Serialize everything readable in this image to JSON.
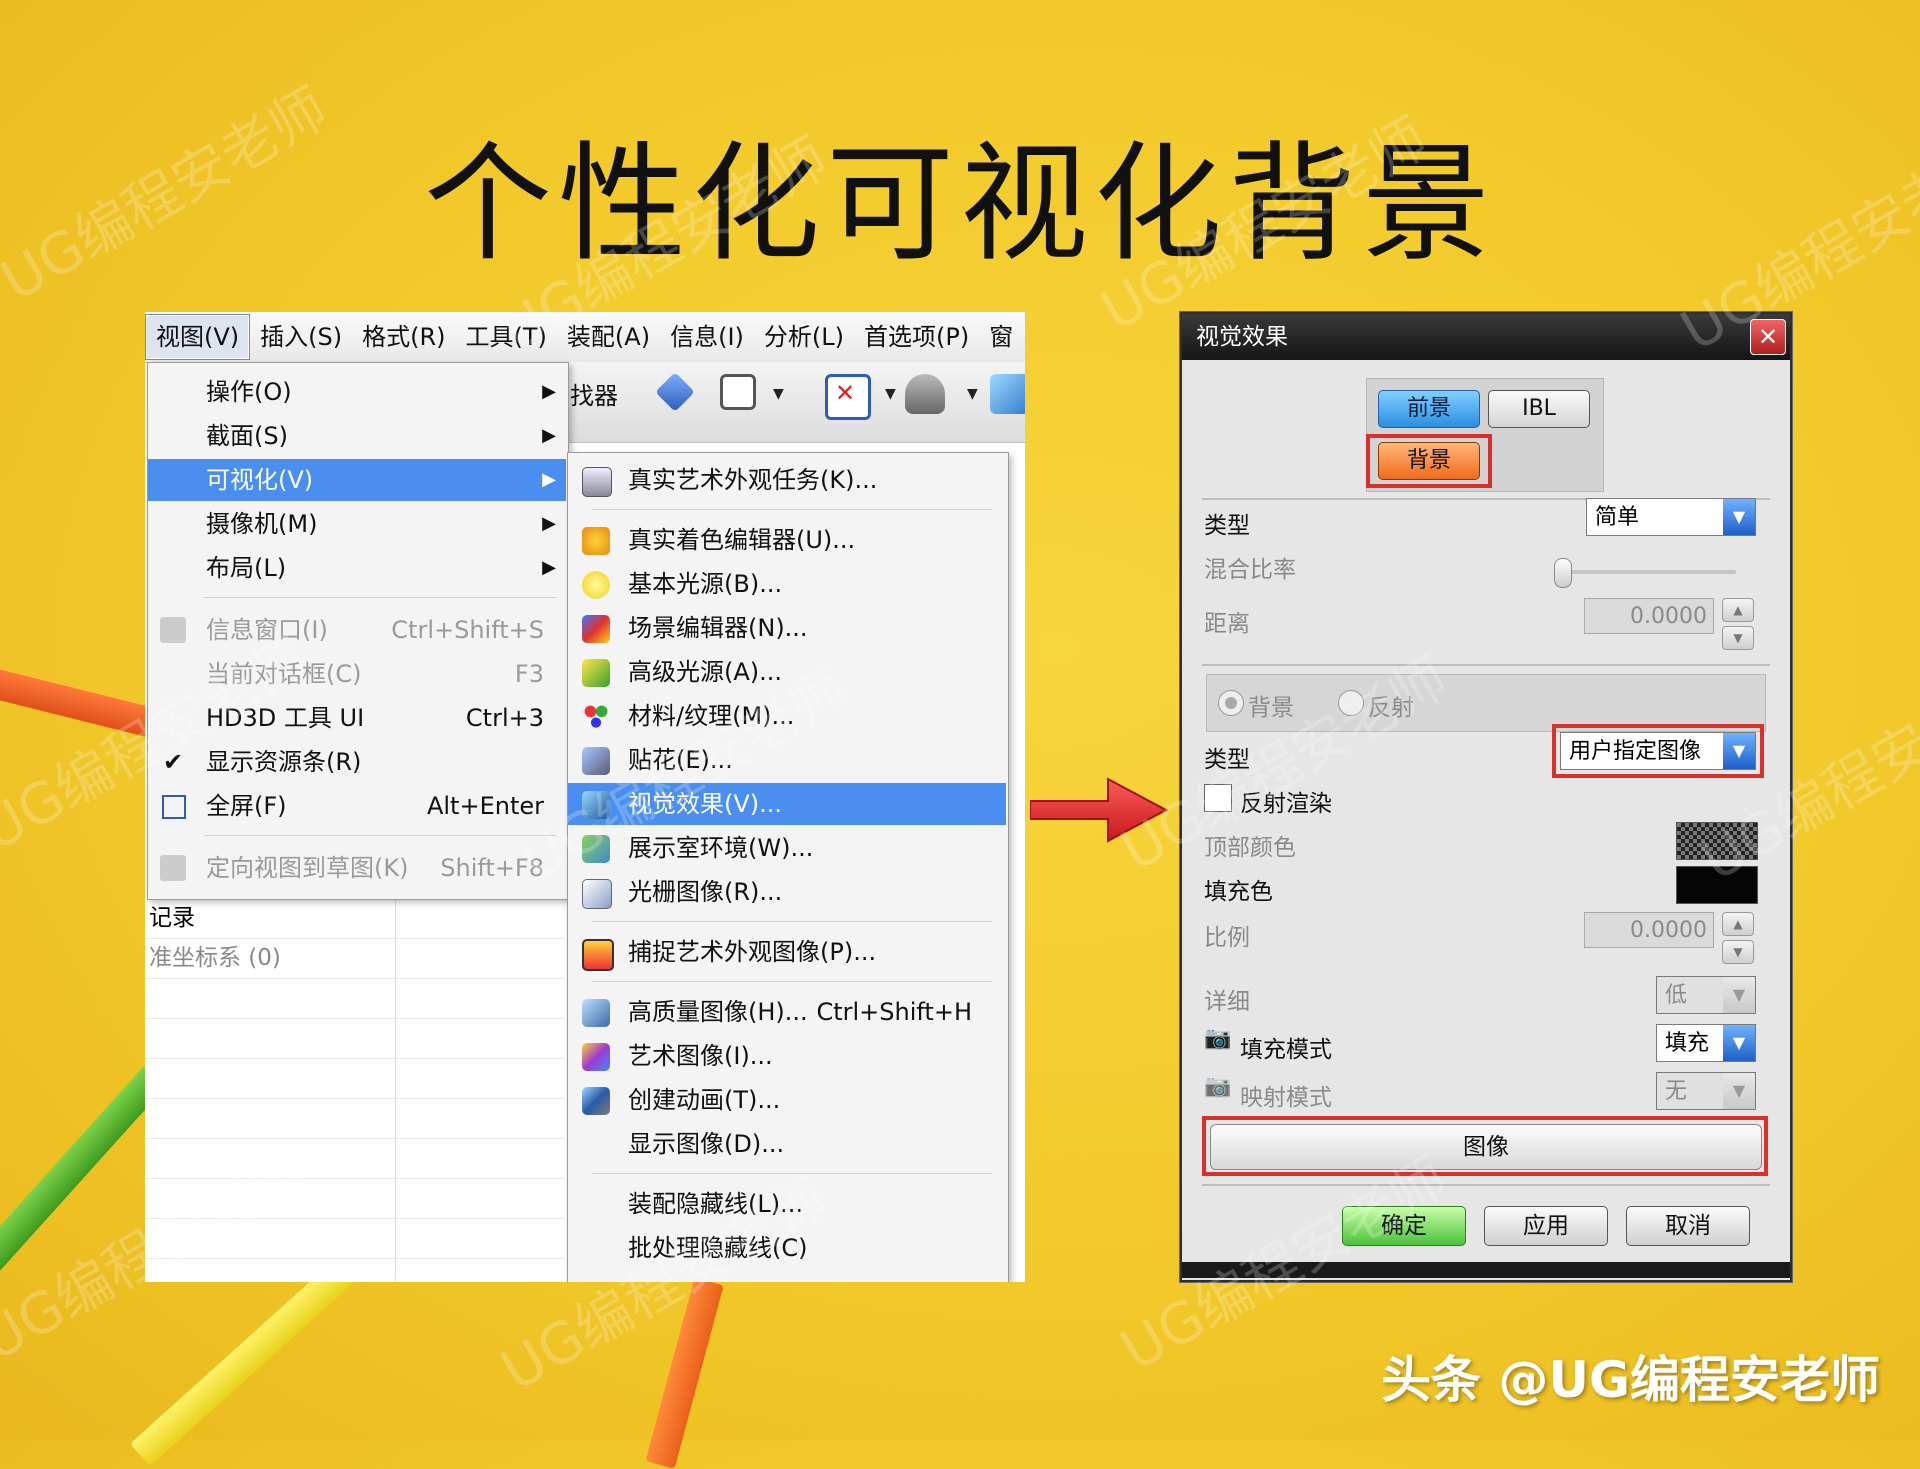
{
  "slide": {
    "title": "个性化可视化背景",
    "watermark": "UG编程安老师",
    "credit": "头条 @UG编程安老师"
  },
  "menubar": {
    "items": [
      "视图(V)",
      "插入(S)",
      "格式(R)",
      "工具(T)",
      "装配(A)",
      "信息(I)",
      "分析(L)",
      "首选项(P)",
      "窗"
    ]
  },
  "toolbar": {
    "partial_label": "找器"
  },
  "view_menu": {
    "items": [
      {
        "label": "操作(O)",
        "submenu": true
      },
      {
        "label": "截面(S)",
        "submenu": true
      },
      {
        "label": "可视化(V)",
        "submenu": true,
        "highlighted": true
      },
      {
        "label": "摄像机(M)",
        "submenu": true
      },
      {
        "label": "布局(L)",
        "submenu": true
      },
      {
        "label": "信息窗口(I)",
        "shortcut": "Ctrl+Shift+S",
        "disabled": true
      },
      {
        "label": "当前对话框(C)",
        "shortcut": "F3",
        "disabled": true
      },
      {
        "label": "HD3D 工具 UI",
        "shortcut": "Ctrl+3"
      },
      {
        "label": "显示资源条(R)",
        "checked": true
      },
      {
        "label": "全屏(F)",
        "shortcut": "Alt+Enter"
      },
      {
        "label": "定向视图到草图(K)",
        "shortcut": "Shift+F8",
        "disabled": true
      }
    ]
  },
  "visual_submenu": {
    "items": [
      {
        "label": "真实艺术外观任务(K)..."
      },
      {
        "label": "真实着色编辑器(U)..."
      },
      {
        "label": "基本光源(B)..."
      },
      {
        "label": "场景编辑器(N)..."
      },
      {
        "label": "高级光源(A)..."
      },
      {
        "label": "材料/纹理(M)..."
      },
      {
        "label": "贴花(E)..."
      },
      {
        "label": "视觉效果(V)...",
        "highlighted": true
      },
      {
        "label": "展示室环境(W)..."
      },
      {
        "label": "光栅图像(R)..."
      },
      {
        "label": "捕捉艺术外观图像(P)..."
      },
      {
        "label": "高质量图像(H)...",
        "shortcut": "Ctrl+Shift+H"
      },
      {
        "label": "艺术图像(I)..."
      },
      {
        "label": "创建动画(T)..."
      },
      {
        "label": "显示图像(D)..."
      },
      {
        "label": "装配隐藏线(L)..."
      },
      {
        "label": "批处理隐藏线(C)"
      }
    ]
  },
  "navigator": {
    "rows": [
      "记录",
      "准坐标系 (0)"
    ]
  },
  "dialog": {
    "title": "视觉效果",
    "tabs": {
      "foreground": "前景",
      "ibl": "IBL",
      "background": "背景"
    },
    "type_label": "类型",
    "type_value": "简单",
    "blend_label": "混合比率",
    "distance_label": "距离",
    "distance_value": "0.0000",
    "radio_background": "背景",
    "radio_reflection": "反射",
    "type2_label": "类型",
    "type2_value": "用户指定图像",
    "reflect_render_label": "反射渲染",
    "top_color_label": "顶部颜色",
    "fill_color_label": "填充色",
    "scale_label": "比例",
    "scale_value": "0.0000",
    "detail_label": "详细",
    "detail_value": "低",
    "fill_mode_label": "填充模式",
    "fill_mode_value": "填充",
    "map_mode_label": "映射模式",
    "map_mode_value": "无",
    "image_button": "图像",
    "ok": "确定",
    "apply": "应用",
    "cancel": "取消"
  }
}
